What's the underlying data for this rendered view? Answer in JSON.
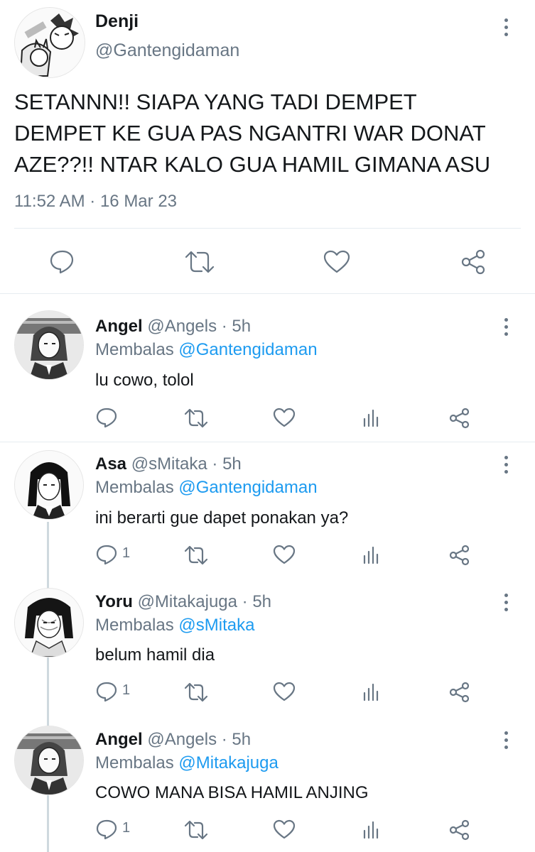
{
  "main_tweet": {
    "display_name": "Denji",
    "handle": "@Gantengidaman",
    "text_lines": [
      "SETANNN!! SIAPA YANG TADI DEMPET",
      "DEMPET KE GUA PAS NGANTRI WAR DONAT",
      "AZE??!! NTAR KALO GUA HAMIL GIMANA ASU"
    ],
    "timestamp": "11:52 AM · 16 Mar 23"
  },
  "replies": [
    {
      "display_name": "Angel",
      "handle_time": "@Angels · 5h",
      "replying_prefix": "Membalas",
      "replying_to": "@Gantengidaman",
      "text": "lu cowo, tolol",
      "reply_count": ""
    },
    {
      "display_name": "Asa",
      "handle_time": "@sMitaka · 5h",
      "replying_prefix": "Membalas",
      "replying_to": "@Gantengidaman",
      "text": "ini berarti gue dapet ponakan ya?",
      "reply_count": "1"
    },
    {
      "display_name": "Yoru",
      "handle_time": "@Mitakajuga · 5h",
      "replying_prefix": "Membalas",
      "replying_to": "@sMitaka",
      "text": "belum hamil dia",
      "reply_count": "1"
    },
    {
      "display_name": "Angel",
      "handle_time": "@Angels · 5h",
      "replying_prefix": "Membalas",
      "replying_to": "@Mitakajuga",
      "text": "COWO MANA BISA HAMIL ANJING",
      "reply_count": "1"
    }
  ],
  "colors": {
    "text": "#14171a",
    "muted": "#687684",
    "link": "#1d9bf0",
    "divider": "#e6ecf0"
  },
  "icons": [
    "more-vertical-icon",
    "reply-icon",
    "retweet-icon",
    "like-icon",
    "share-icon",
    "analytics-icon"
  ]
}
